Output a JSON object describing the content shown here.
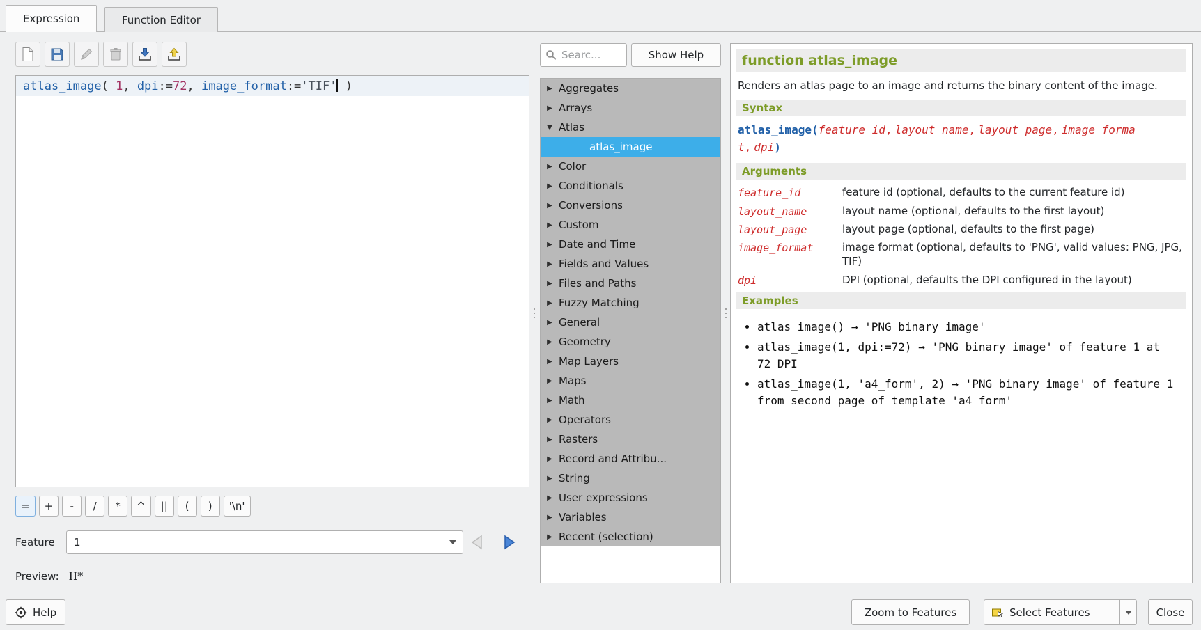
{
  "tabs": [
    {
      "label": "Expression",
      "active": true
    },
    {
      "label": "Function Editor",
      "active": false
    }
  ],
  "toolbar_icons": [
    "new-expression",
    "save-expression",
    "edit-expression",
    "delete-expression",
    "import-expression",
    "export-expression"
  ],
  "expression": {
    "tokens": [
      {
        "text": "atlas_image",
        "type": "function"
      },
      {
        "text": "( ",
        "type": "plain"
      },
      {
        "text": "1",
        "type": "number"
      },
      {
        "text": ", ",
        "type": "plain"
      },
      {
        "text": "dpi",
        "type": "function"
      },
      {
        "text": ":=",
        "type": "plain"
      },
      {
        "text": "72",
        "type": "number"
      },
      {
        "text": ", ",
        "type": "plain"
      },
      {
        "text": "image_format",
        "type": "function"
      },
      {
        "text": ":=",
        "type": "plain"
      },
      {
        "text": "'TIF'",
        "type": "string"
      },
      {
        "text": " )",
        "type": "plain"
      }
    ]
  },
  "operator_buttons": [
    "=",
    "+",
    "-",
    "/",
    "*",
    "^",
    "||",
    "(",
    ")",
    "'\\n'"
  ],
  "feature": {
    "label": "Feature",
    "value": "1"
  },
  "preview": {
    "label": "Preview:",
    "value": "II*"
  },
  "search": {
    "placeholder": "Searc...",
    "show_help": "Show Help"
  },
  "function_tree": [
    {
      "label": "Aggregates",
      "type": "group"
    },
    {
      "label": "Arrays",
      "type": "group"
    },
    {
      "label": "Atlas",
      "type": "group",
      "expanded": true
    },
    {
      "label": "atlas_image",
      "type": "function",
      "selected": true
    },
    {
      "label": "Color",
      "type": "group"
    },
    {
      "label": "Conditionals",
      "type": "group"
    },
    {
      "label": "Conversions",
      "type": "group"
    },
    {
      "label": "Custom",
      "type": "group"
    },
    {
      "label": "Date and Time",
      "type": "group"
    },
    {
      "label": "Fields and Values",
      "type": "group"
    },
    {
      "label": "Files and Paths",
      "type": "group"
    },
    {
      "label": "Fuzzy Matching",
      "type": "group"
    },
    {
      "label": "General",
      "type": "group"
    },
    {
      "label": "Geometry",
      "type": "group"
    },
    {
      "label": "Map Layers",
      "type": "group"
    },
    {
      "label": "Maps",
      "type": "group"
    },
    {
      "label": "Math",
      "type": "group"
    },
    {
      "label": "Operators",
      "type": "group"
    },
    {
      "label": "Rasters",
      "type": "group"
    },
    {
      "label": "Record and Attribu...",
      "type": "group"
    },
    {
      "label": "String",
      "type": "group"
    },
    {
      "label": "User expressions",
      "type": "group"
    },
    {
      "label": "Variables",
      "type": "group"
    },
    {
      "label": "Recent (selection)",
      "type": "group"
    }
  ],
  "help": {
    "title": "function atlas_image",
    "description": "Renders an atlas page to an image and returns the binary content of the image.",
    "syntax_heading": "Syntax",
    "syntax": {
      "fn": "atlas_image",
      "open": "(",
      "args": [
        "feature_id",
        "layout_name",
        "layout_page",
        "image_format",
        "dpi"
      ],
      "separator": ",",
      "close": ")"
    },
    "arguments_heading": "Arguments",
    "arguments": [
      {
        "name": "feature_id",
        "desc": "feature id (optional, defaults to the current feature id)"
      },
      {
        "name": "layout_name",
        "desc": "layout name (optional, defaults to the first layout)"
      },
      {
        "name": "layout_page",
        "desc": "layout page (optional, defaults to the first page)"
      },
      {
        "name": "image_format",
        "desc": "image format (optional, defaults to 'PNG', valid values: PNG, JPG, TIF)"
      },
      {
        "name": "dpi",
        "desc": "DPI (optional, defaults the DPI configured in the layout)"
      }
    ],
    "examples_heading": "Examples",
    "examples": [
      "atlas_image() → 'PNG binary image'",
      "atlas_image(1, dpi:=72) → 'PNG binary image' of feature 1 at 72 DPI",
      "atlas_image(1, 'a4_form', 2) → 'PNG binary image' of feature 1 from second page of template 'a4_form'"
    ]
  },
  "footer": {
    "help": "Help",
    "zoom_to_features": "Zoom to Features",
    "select_features": "Select Features",
    "close": "Close"
  },
  "colors": {
    "selection": "#3daee9",
    "heading_green": "#7d9c28",
    "code_blue": "#2160a8",
    "code_red": "#ce2c2c",
    "number": "#a33262",
    "tree_row_bg": "#b9b9b9"
  }
}
